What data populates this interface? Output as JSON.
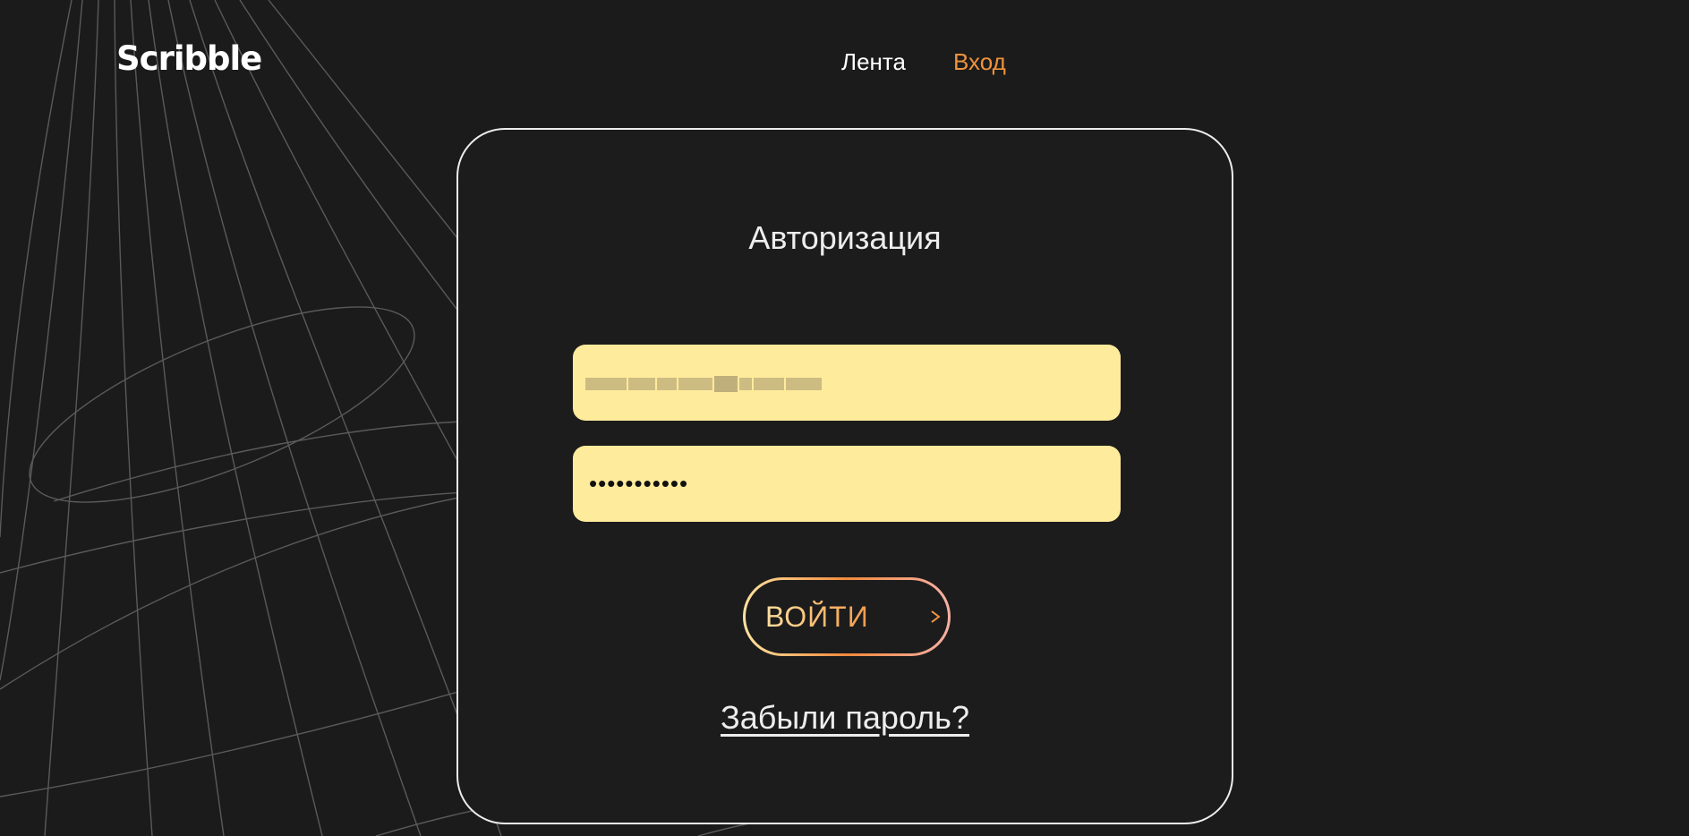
{
  "header": {
    "logo": "Scribble",
    "nav": {
      "feed": "Лента",
      "login": "Вход"
    }
  },
  "auth_card": {
    "title": "Авторизация",
    "email_value": "",
    "password_value": "•••••••••••",
    "submit_label": "ВОЙТИ",
    "forgot_label": "Забыли пароль?"
  },
  "colors": {
    "background": "#1b1b1b",
    "accent": "#f0923c",
    "field_fill": "#ffeb9c",
    "text": "#ededed"
  }
}
